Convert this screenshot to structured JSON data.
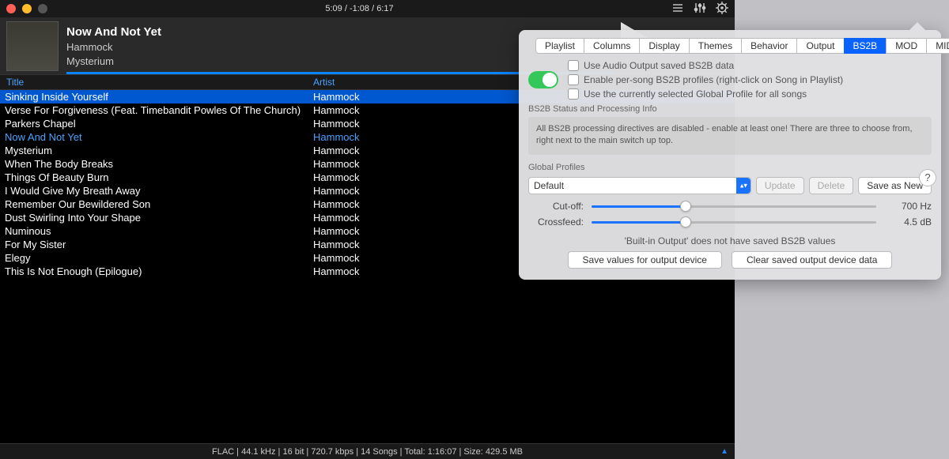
{
  "titlebar": {
    "time_display": "5:09 / -1:08 / 6:17"
  },
  "now_playing": {
    "title": "Now And Not Yet",
    "artist": "Hammock",
    "album": "Mysterium"
  },
  "columns": {
    "title": "Title",
    "artist": "Artist"
  },
  "tracks": [
    {
      "title": "Sinking Inside Yourself",
      "artist": "Hammock",
      "selected": true
    },
    {
      "title": "Verse For Forgiveness (Feat. Timebandit Powles Of The Church)",
      "artist": "Hammock"
    },
    {
      "title": "Parkers Chapel",
      "artist": "Hammock"
    },
    {
      "title": "Now And Not Yet",
      "artist": "Hammock",
      "current": true
    },
    {
      "title": "Mysterium",
      "artist": "Hammock"
    },
    {
      "title": "When The Body Breaks",
      "artist": "Hammock"
    },
    {
      "title": "Things Of Beauty Burn",
      "artist": "Hammock"
    },
    {
      "title": "I Would Give My Breath Away",
      "artist": "Hammock"
    },
    {
      "title": "Remember Our Bewildered Son",
      "artist": "Hammock"
    },
    {
      "title": "Dust Swirling Into Your Shape",
      "artist": "Hammock"
    },
    {
      "title": "Numinous",
      "artist": "Hammock"
    },
    {
      "title": "For My Sister",
      "artist": "Hammock"
    },
    {
      "title": "Elegy",
      "artist": "Hammock"
    },
    {
      "title": "This Is Not Enough  (Epilogue)",
      "artist": "Hammock"
    }
  ],
  "statusbar": "FLAC | 44.1 kHz | 16 bit | 720.7 kbps | 14 Songs | Total: 1:16:07 | Size: 429.5 MB",
  "prefs": {
    "tabs": [
      "Playlist",
      "Columns",
      "Display",
      "Themes",
      "Behavior",
      "Output",
      "BS2B",
      "MOD",
      "MIDI"
    ],
    "active_tab": "BS2B",
    "checks": [
      "Use Audio Output saved BS2B data",
      "Enable per-song BS2B profiles (right-click on Song in Playlist)",
      "Use the currently selected Global Profile for all songs"
    ],
    "status_label": "BS2B Status and Processing Info",
    "info_text": "All BS2B processing directives are disabled - enable at least one! There are three to choose from, right next to the main switch up top.",
    "global_label": "Global Profiles",
    "dropdown_value": "Default",
    "update": "Update",
    "delete": "Delete",
    "save_new": "Save as New",
    "cutoff_label": "Cut-off:",
    "cutoff_value": "700 Hz",
    "cutoff_percent": 33,
    "crossfeed_label": "Crossfeed:",
    "crossfeed_value": "4.5 dB",
    "crossfeed_percent": 33,
    "notice": "'Built-in Output' does not have saved BS2B values",
    "save_device": "Save values for output device",
    "clear_device": "Clear saved output device data",
    "help": "?"
  }
}
